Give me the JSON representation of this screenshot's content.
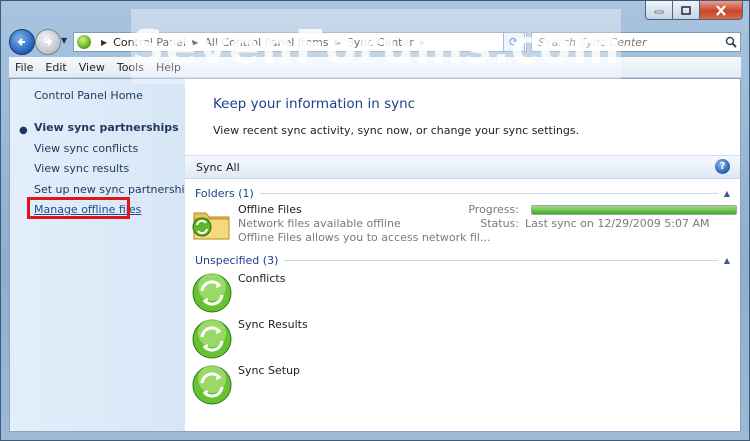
{
  "window": {
    "title_buttons": {
      "minimize_icon": "minimize-icon",
      "maximize_icon": "maximize-icon",
      "close_icon": "close-icon"
    },
    "watermark": "SevenForums.com"
  },
  "nav": {
    "breadcrumbs": [
      "Control Panel",
      "All Control Panel Items",
      "Sync Center"
    ],
    "search_placeholder": "Search Sync Center"
  },
  "menu": [
    "File",
    "Edit",
    "View",
    "Tools",
    "Help"
  ],
  "left_pane": {
    "home": "Control Panel Home",
    "links": [
      {
        "label": "View sync partnerships",
        "active": true
      },
      {
        "label": "View sync conflicts"
      },
      {
        "label": "View sync results"
      },
      {
        "label": "Set up new sync partnerships"
      }
    ],
    "manage_offline": "Manage offline files"
  },
  "main": {
    "title": "Keep your information in sync",
    "description": "View recent sync activity, sync now, or change your sync settings.",
    "toolbar": {
      "sync_all": "Sync All",
      "help": "?"
    },
    "groups": [
      {
        "header": "Folders (1)",
        "items": [
          {
            "name": "Offline Files",
            "line1": "Network files available offline",
            "line2": "Offline Files allows you to access network fil...",
            "progress_label": "Progress:",
            "progress_value": 1.0,
            "status_label": "Status:",
            "status_value": "Last sync on 12/29/2009 5:07 AM"
          }
        ]
      },
      {
        "header": "Unspecified (3)",
        "items": [
          {
            "name": "Conflicts"
          },
          {
            "name": "Sync Results"
          },
          {
            "name": "Sync Setup"
          }
        ]
      }
    ]
  },
  "colors": {
    "accent_blue": "#1e3f8c",
    "highlight_red": "#e0151b",
    "sync_green": "#51a31a"
  }
}
